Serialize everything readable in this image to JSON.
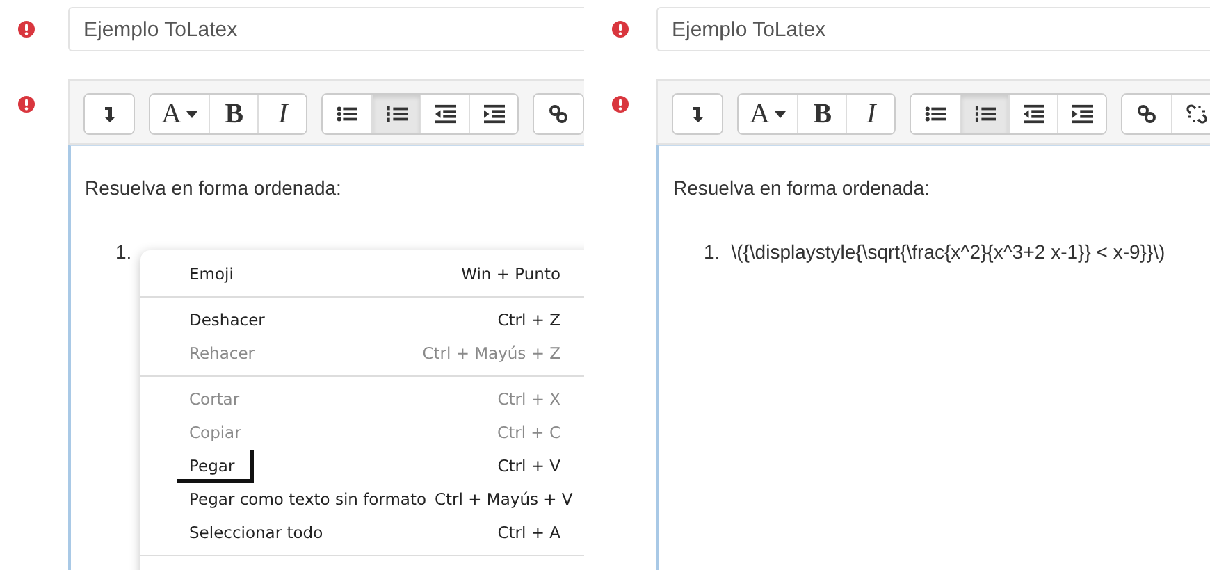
{
  "panels": [
    {
      "title_field": {
        "value": "Ejemplo ToLatex"
      },
      "toolbar": [
        [
          {
            "kind": "insert",
            "selected": false
          }
        ],
        [
          {
            "kind": "text-color",
            "label": "A",
            "selected": false
          },
          {
            "kind": "bold",
            "label": "B",
            "selected": false
          },
          {
            "kind": "italic",
            "label": "I",
            "selected": false
          }
        ],
        [
          {
            "kind": "bullet-list",
            "selected": false
          },
          {
            "kind": "numbered-list",
            "selected": true
          },
          {
            "kind": "outdent",
            "selected": false
          },
          {
            "kind": "indent",
            "selected": false
          }
        ],
        [
          {
            "kind": "link",
            "selected": false
          }
        ]
      ],
      "content": {
        "heading": "Resuelva en forma ordenada:",
        "list_number": "1."
      },
      "context_menu": {
        "groups": [
          [
            {
              "label": "Emoji",
              "shortcut": "Win + Punto",
              "disabled": false,
              "marked": false
            }
          ],
          [
            {
              "label": "Deshacer",
              "shortcut": "Ctrl + Z",
              "disabled": false,
              "marked": false
            },
            {
              "label": "Rehacer",
              "shortcut": "Ctrl + Mayús + Z",
              "disabled": true,
              "marked": false
            }
          ],
          [
            {
              "label": "Cortar",
              "shortcut": "Ctrl + X",
              "disabled": true,
              "marked": false
            },
            {
              "label": "Copiar",
              "shortcut": "Ctrl + C",
              "disabled": true,
              "marked": false
            },
            {
              "label": "Pegar",
              "shortcut": "Ctrl + V",
              "disabled": false,
              "marked": true
            },
            {
              "label": "Pegar como texto sin formato",
              "shortcut": "Ctrl + Mayús + V",
              "disabled": false,
              "marked": false
            },
            {
              "label": "Seleccionar todo",
              "shortcut": "Ctrl + A",
              "disabled": false,
              "marked": false
            }
          ]
        ]
      }
    },
    {
      "title_field": {
        "value": "Ejemplo ToLatex"
      },
      "toolbar": [
        [
          {
            "kind": "insert",
            "selected": false
          }
        ],
        [
          {
            "kind": "text-color",
            "label": "A",
            "selected": false
          },
          {
            "kind": "bold",
            "label": "B",
            "selected": false
          },
          {
            "kind": "italic",
            "label": "I",
            "selected": false
          }
        ],
        [
          {
            "kind": "bullet-list",
            "selected": false
          },
          {
            "kind": "numbered-list",
            "selected": true
          },
          {
            "kind": "outdent",
            "selected": false
          },
          {
            "kind": "indent",
            "selected": false
          }
        ],
        [
          {
            "kind": "link",
            "selected": false
          },
          {
            "kind": "unlink",
            "selected": false
          }
        ]
      ],
      "content": {
        "heading": "Resuelva en forma ordenada:",
        "list_number": "1.",
        "list_text": "\\({\\displaystyle{\\sqrt{\\frac{x^2}{x^3+2 x-1}} < x-9}}\\)"
      }
    }
  ]
}
